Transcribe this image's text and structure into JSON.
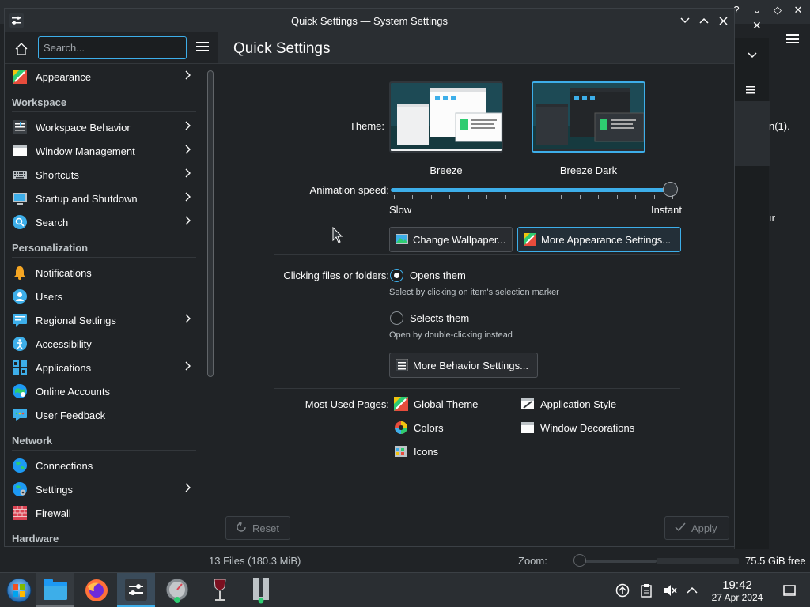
{
  "background_app": {
    "status_files": "13 Files (180.3 MiB)",
    "zoom_label": "Zoom:",
    "free_space": "75.5 GiB free",
    "text_fragment_1": "n(1).",
    "text_fragment_2": "ır"
  },
  "window": {
    "title": "Quick Settings — System Settings",
    "controls": [
      "minimize-icon",
      "maximize-icon",
      "close-icon"
    ]
  },
  "sidebar": {
    "search_placeholder": "Search...",
    "top_item": {
      "label": "Appearance",
      "icon": "appearance-icon",
      "has_children": true
    },
    "sections": [
      {
        "title": "Workspace",
        "items": [
          {
            "label": "Workspace Behavior",
            "icon": "workspace-behavior-icon",
            "has_children": true
          },
          {
            "label": "Window Management",
            "icon": "window-management-icon",
            "has_children": true
          },
          {
            "label": "Shortcuts",
            "icon": "keyboard-icon",
            "has_children": true
          },
          {
            "label": "Startup and Shutdown",
            "icon": "startup-icon",
            "has_children": true
          },
          {
            "label": "Search",
            "icon": "search-icon",
            "has_children": true
          }
        ]
      },
      {
        "title": "Personalization",
        "items": [
          {
            "label": "Notifications",
            "icon": "bell-icon",
            "has_children": false
          },
          {
            "label": "Users",
            "icon": "users-icon",
            "has_children": false
          },
          {
            "label": "Regional Settings",
            "icon": "regional-icon",
            "has_children": true
          },
          {
            "label": "Accessibility",
            "icon": "accessibility-icon",
            "has_children": false
          },
          {
            "label": "Applications",
            "icon": "applications-icon",
            "has_children": true
          },
          {
            "label": "Online Accounts",
            "icon": "online-accounts-icon",
            "has_children": false
          },
          {
            "label": "User Feedback",
            "icon": "feedback-icon",
            "has_children": false
          }
        ]
      },
      {
        "title": "Network",
        "items": [
          {
            "label": "Connections",
            "icon": "globe-icon",
            "has_children": false
          },
          {
            "label": "Settings",
            "icon": "network-settings-icon",
            "has_children": true
          },
          {
            "label": "Firewall",
            "icon": "firewall-icon",
            "has_children": false
          }
        ]
      },
      {
        "title": "Hardware",
        "items": []
      }
    ]
  },
  "content": {
    "title": "Quick Settings",
    "theme_label": "Theme:",
    "themes": [
      {
        "name": "Breeze",
        "selected": false
      },
      {
        "name": "Breeze Dark",
        "selected": true
      }
    ],
    "animation_label": "Animation speed:",
    "animation_speed": 1.0,
    "slider_min": "Slow",
    "slider_max": "Instant",
    "change_wallpaper": "Change Wallpaper...",
    "more_appearance": "More Appearance Settings...",
    "clicking_label": "Clicking files or folders:",
    "opt_open": "Opens them",
    "opt_open_hint": "Select by clicking on item's selection marker",
    "opt_select": "Selects them",
    "opt_select_hint": "Open by double-clicking instead",
    "more_behavior": "More Behavior Settings...",
    "most_used_label": "Most Used Pages:",
    "most_used": [
      "Global Theme",
      "Application Style",
      "Colors",
      "Window Decorations",
      "Icons"
    ],
    "reset": "Reset",
    "apply": "Apply"
  },
  "taskbar": {
    "apps": [
      "start-menu-icon",
      "file-manager-icon",
      "firefox-icon",
      "system-settings-icon",
      "disk-usage-icon",
      "wine-icon",
      "archive-icon"
    ],
    "clock": "19:42",
    "date": "27 Apr 2024"
  },
  "colors": {
    "accent": "#3daee9",
    "window_bg": "#202326",
    "header_bg": "#2a2e32"
  }
}
